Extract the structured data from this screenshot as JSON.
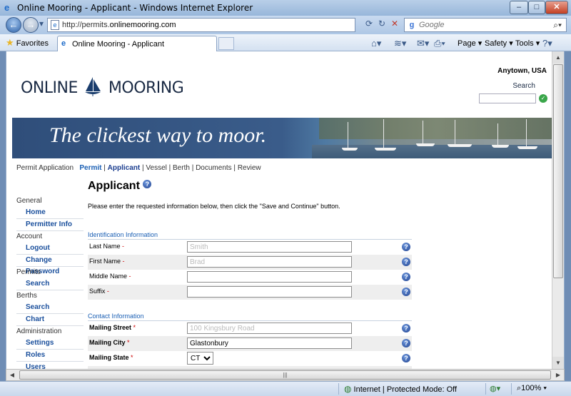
{
  "window": {
    "title": "Online Mooring - Applicant - Windows Internet Explorer",
    "minimize": "–",
    "maximize": "□",
    "close": "✕"
  },
  "address": {
    "url_prefix": "http://permits.",
    "url_host": "onlinemooring.com",
    "search_placeholder": "Google"
  },
  "commandbar": {
    "favorites": "Favorites",
    "tab_title": "Online Mooring - Applicant",
    "page": "Page ▾",
    "safety": "Safety ▾",
    "tools": "Tools ▾"
  },
  "site": {
    "logo_left": "ONLINE",
    "logo_right": "MOORING",
    "location": "Anytown, USA",
    "search_label": "Search",
    "tagline": "The clickest way to moor."
  },
  "breadcrumb": {
    "prefix": "Permit Application",
    "steps": [
      "Permit",
      "Applicant",
      "Vessel",
      "Berth",
      "Documents",
      "Review"
    ]
  },
  "sidebar": {
    "sections": [
      {
        "label": "General",
        "items": [
          "Home",
          "Permitter Info"
        ]
      },
      {
        "label": "Account",
        "items": [
          "Logout",
          "Change Password"
        ]
      },
      {
        "label": "Permits",
        "items": [
          "Search"
        ]
      },
      {
        "label": "Berths",
        "items": [
          "Search",
          "Chart"
        ]
      },
      {
        "label": "Administration",
        "items": [
          "Settings",
          "Roles",
          "Users"
        ]
      }
    ]
  },
  "main": {
    "title": "Applicant",
    "instructions": "Please enter the requested information below, then click the \"Save and Continue\" button.",
    "identification": {
      "heading": "Identification Information",
      "fields": [
        {
          "label": "Last Name",
          "value": "Smith"
        },
        {
          "label": "First Name",
          "value": "Brad"
        },
        {
          "label": "Middle Name",
          "value": ""
        },
        {
          "label": "Suffix",
          "value": ""
        }
      ]
    },
    "contact": {
      "heading": "Contact Information",
      "fields": [
        {
          "label": "Mailing Street",
          "value": "100 Kingsbury Road"
        },
        {
          "label": "Mailing City",
          "value": "Glastonbury"
        },
        {
          "label": "Mailing State",
          "value": "CT"
        }
      ]
    }
  },
  "status": {
    "zone": "Internet | Protected Mode: Off",
    "zoom": "100%"
  },
  "colors": {
    "link": "#1a5fb4",
    "banner": "#2f4e7a",
    "required": "#cc0000"
  }
}
